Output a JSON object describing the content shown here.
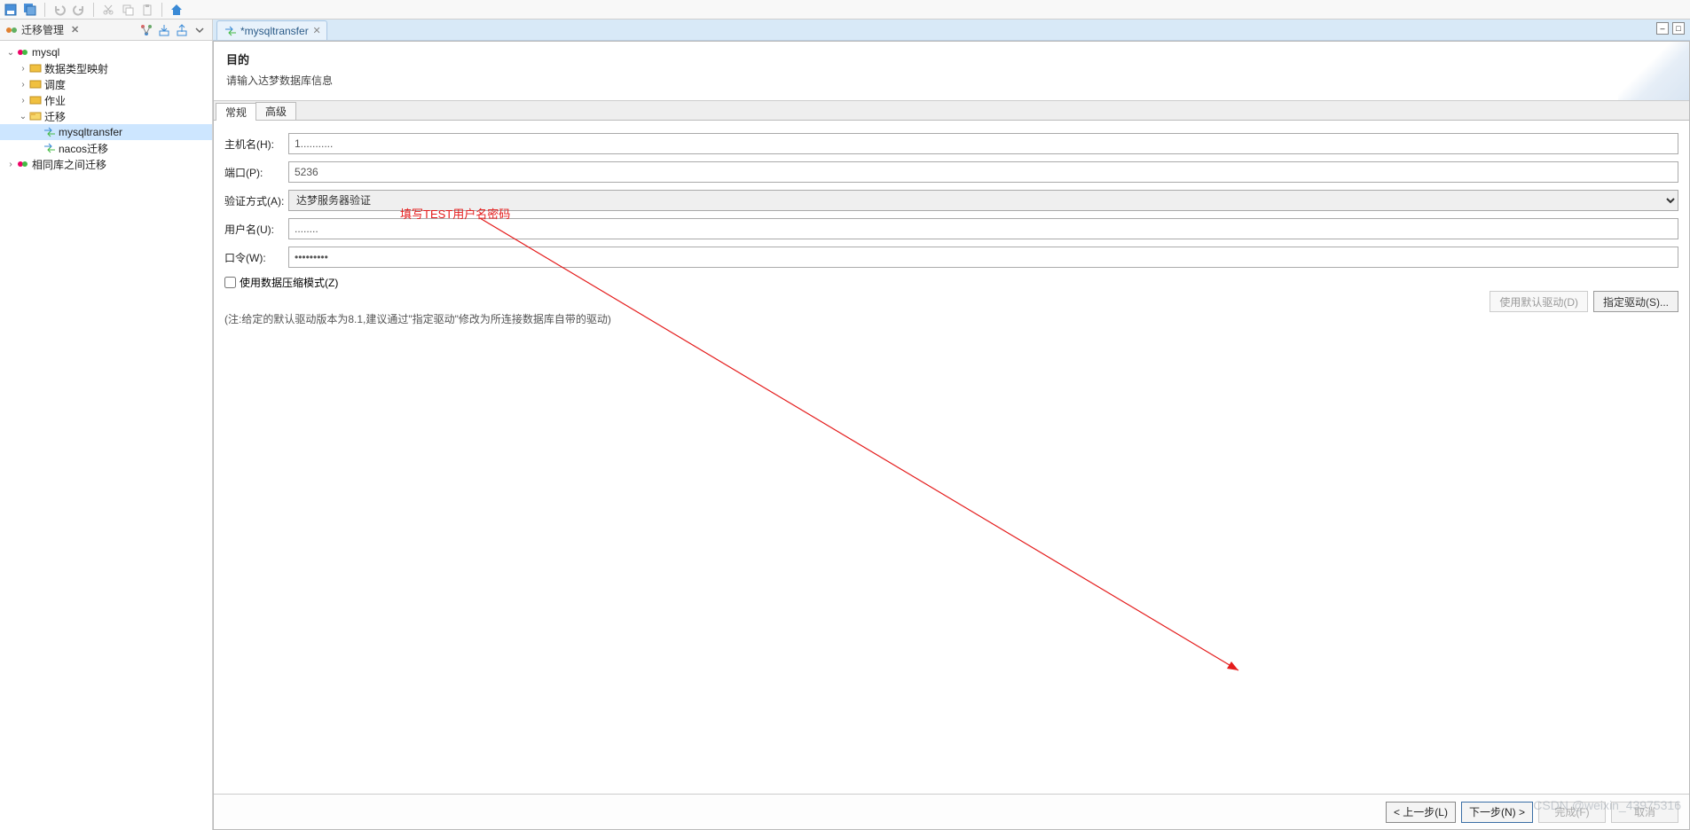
{
  "toolbar": {
    "icons": [
      "save-icon",
      "save-all-icon",
      "undo-icon",
      "redo-icon",
      "cut-icon",
      "copy-icon",
      "paste-icon",
      "home-icon"
    ]
  },
  "sidebar": {
    "title": "迁移管理",
    "right_icons": [
      "tree-nodes-icon",
      "import-icon",
      "export-icon",
      "menu-icon"
    ],
    "tree": {
      "root": "mysql",
      "items": [
        "数据类型映射",
        "调度",
        "作业",
        "迁移"
      ],
      "migrate_children": [
        "mysqltransfer",
        "nacos迁移"
      ],
      "sibling": "相同库之间迁移"
    }
  },
  "editor": {
    "tab_title": "*mysqltransfer"
  },
  "wizard": {
    "title": "目的",
    "subtitle": "请输入达梦数据库信息",
    "sub_tabs": [
      "常规",
      "高级"
    ],
    "form": {
      "host_label": "主机名(H):",
      "host_value": "1...........",
      "port_label": "端口(P):",
      "port_value": "5236",
      "auth_label": "验证方式(A):",
      "auth_value": "达梦服务器验证",
      "user_label": "用户名(U):",
      "user_value": "........",
      "pwd_label": "口令(W):",
      "pwd_value": "•••••••••",
      "compress_label": "使用数据压缩模式(Z)",
      "use_default_driver": "使用默认驱动(D)",
      "specify_driver": "指定驱动(S)...",
      "note": "(注:给定的默认驱动版本为8.1,建议通过\"指定驱动\"修改为所连接数据库自带的驱动)"
    },
    "annotation": "填写TEST用户名密码",
    "footer": {
      "prev": "< 上一步(L)",
      "next": "下一步(N) >",
      "finish": "完成(F)",
      "cancel": "取消"
    }
  },
  "watermark": "CSDN @weixin_43975316"
}
